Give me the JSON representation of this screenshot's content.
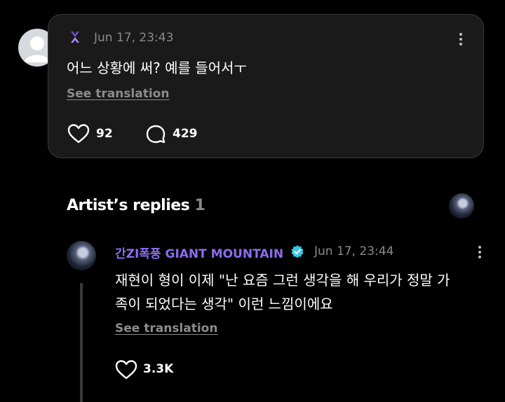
{
  "comment": {
    "timestamp": "Jun 17, 23:43",
    "text": "어느 상황에 써? 예를 들어서ㅜ",
    "see_translation": "See translation",
    "likes": "92",
    "replies": "429"
  },
  "artist_replies": {
    "title": "Artist’s replies",
    "count": "1"
  },
  "reply": {
    "name_korean": "간ZI폭풍",
    "name_english": "GIANT MOUNTAIN",
    "timestamp": "Jun 17, 23:44",
    "text_line1": "재현이 형이 이제 \"난 요즘 그런 생각을 해 우리가 정말 가",
    "text_line2": "족이 되었다는 생각\" 이런 느낌이에요",
    "see_translation": "See translation",
    "likes": "3.3K"
  },
  "colors": {
    "accent": "#8d6cf0",
    "verified": "#39c6e6",
    "card_bg": "#1a1a1a"
  },
  "icons": [
    "user-placeholder-icon",
    "fan-badge-icon",
    "more-options-icon",
    "heart-icon",
    "comment-bubble-icon",
    "verified-icon"
  ]
}
